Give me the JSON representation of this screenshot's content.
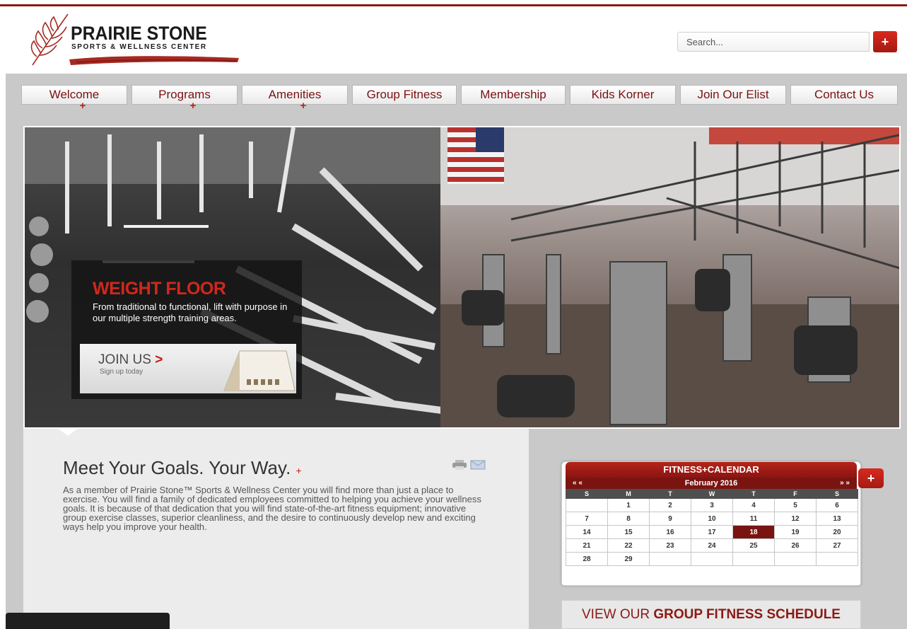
{
  "header": {
    "logo_title": "PRAIRIE STONE",
    "logo_subtitle": "SPORTS & WELLNESS CENTER",
    "search_placeholder": "Search...",
    "search_button": "+"
  },
  "nav": {
    "items": [
      {
        "label": "Welcome",
        "has_submenu": true
      },
      {
        "label": "Programs",
        "has_submenu": true
      },
      {
        "label": "Amenities",
        "has_submenu": true
      },
      {
        "label": "Group Fitness",
        "has_submenu": false
      },
      {
        "label": "Membership",
        "has_submenu": false
      },
      {
        "label": "Kids Korner",
        "has_submenu": false
      },
      {
        "label": "Join Our Elist",
        "has_submenu": false
      },
      {
        "label": "Contact Us",
        "has_submenu": false
      }
    ],
    "submenu_marker": "+"
  },
  "hero": {
    "title": "WEIGHT FLOOR",
    "text": "From traditional to functional, lift with purpose in our multiple strength training areas.",
    "cta_label": "JOIN US",
    "cta_arrow": ">",
    "cta_sub": "Sign up today"
  },
  "main": {
    "title": "Meet Your Goals. Your Way.",
    "title_marker": "+",
    "body": "As a member of Prairie Stone™ Sports & Wellness Center you will find more than just a place to exercise. You will find a family of dedicated employees committed to helping you achieve your wellness goals. It is because of that dedication that you will find state-of-the-art fitness equipment; innovative group exercise classes, superior cleanliness, and the desire to continuously develop new and exciting ways help you improve your health."
  },
  "calendar": {
    "title": "FITNESS+CALENDAR",
    "month": "February 2016",
    "prev": "« «",
    "next": "» »",
    "weekdays": [
      "S",
      "M",
      "T",
      "W",
      "T",
      "F",
      "S"
    ],
    "weeks": [
      [
        "",
        "1",
        "2",
        "3",
        "4",
        "5",
        "6"
      ],
      [
        "7",
        "8",
        "9",
        "10",
        "11",
        "12",
        "13"
      ],
      [
        "14",
        "15",
        "16",
        "17",
        "18",
        "19",
        "20"
      ],
      [
        "21",
        "22",
        "23",
        "24",
        "25",
        "26",
        "27"
      ],
      [
        "28",
        "29",
        "",
        "",
        "",
        "",
        ""
      ]
    ],
    "today": "18",
    "add_button": "+"
  },
  "schedule": {
    "prefix": "VIEW OUR ",
    "emphasis": "GROUP FITNESS SCHEDULE"
  },
  "colors": {
    "accent": "#c61b12",
    "dark_red": "#7a1411",
    "frame": "#c9c9c9"
  }
}
